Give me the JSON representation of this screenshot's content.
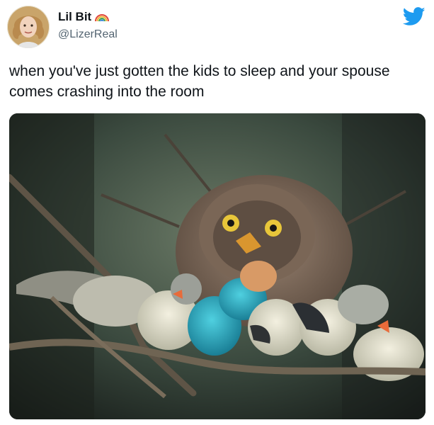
{
  "author": {
    "display_name": "Lil Bit",
    "handle": "@LizerReal",
    "avatar_icon": "user-avatar",
    "name_emoji_icon": "rainbow-icon"
  },
  "brand": {
    "logo_icon": "twitter-bird-icon",
    "accent_color": "#1d9bf0"
  },
  "tweet": {
    "text": "when you've just gotten the kids to sleep and your spouse comes crashing into the room"
  },
  "media": {
    "type": "photo",
    "icon": "photo-owl-with-small-birds"
  }
}
